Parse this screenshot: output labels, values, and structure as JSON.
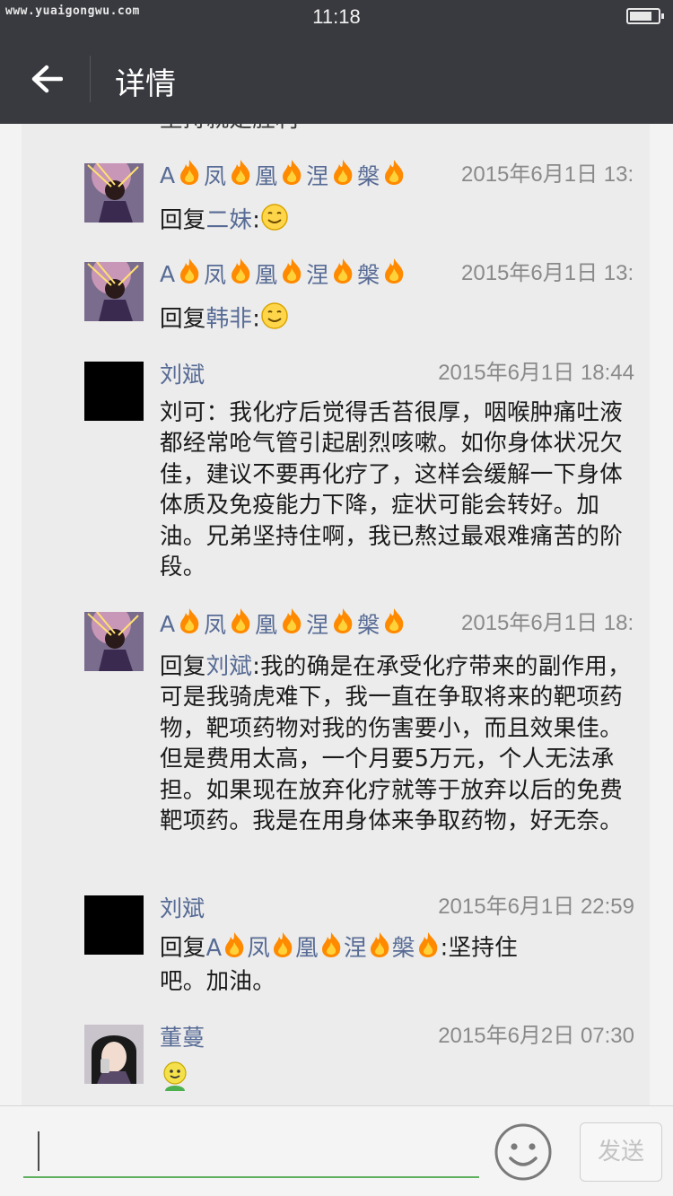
{
  "status_bar": {
    "watermark": "www.yuaigongwu.com",
    "time": "11:18"
  },
  "header": {
    "title": "详情"
  },
  "partial_message": "坚持就是胜利",
  "comments": [
    {
      "name_parts": [
        "A",
        "凤",
        "凰",
        "涅",
        "槃"
      ],
      "time": "2015年6月1日 13:",
      "reply_prefix": "回复",
      "reply_to": "二妹",
      "text": ":"
    },
    {
      "name_parts": [
        "A",
        "凤",
        "凰",
        "涅",
        "槃"
      ],
      "time": "2015年6月1日 13:",
      "reply_prefix": "回复",
      "reply_to": "韩非",
      "text": ":"
    },
    {
      "name": "刘斌",
      "time": "2015年6月1日 18:44",
      "text": "刘可：我化疗后觉得舌苔很厚，咽喉肿痛吐液都经常呛气管引起剧烈咳嗽。如你身体状况欠佳，建议不要再化疗了，这样会缓解一下身体体质及免疫能力下降，症状可能会转好。加油。兄弟坚持住啊，我已熬过最艰难痛苦的阶段。"
    },
    {
      "name_parts": [
        "A",
        "凤",
        "凰",
        "涅",
        "槃"
      ],
      "time": "2015年6月1日 18:",
      "reply_prefix": "回复",
      "reply_to": "刘斌",
      "text": ":我的确是在承受化疗带来的副作用，可是我骑虎难下，我一直在争取将来的靶项药物，靶项药物对我的伤害要小，而且效果佳。但是费用太高，一个月要5万元，个人无法承担。如果现在放弃化疗就等于放弃以后的免费靶项药。我是在用身体来争取药物，好无奈。"
    },
    {
      "name": "刘斌",
      "time": "2015年6月1日 22:59",
      "reply_prefix": "回复",
      "reply_to_parts": [
        "A",
        "凤",
        "凰",
        "涅",
        "槃"
      ],
      "text_line1": ":坚持住",
      "text_line2": "吧。加油。"
    },
    {
      "name": "董蔓",
      "time": "2015年6月2日 07:30"
    }
  ],
  "input_bar": {
    "send_label": "发送"
  },
  "icons": {
    "back": "arrow-left-icon",
    "emoji": "smiley-face-icon",
    "flame": "fire-emoji-icon",
    "smile": "smile-emoji-icon"
  },
  "colors": {
    "bar": "#393a3f",
    "link": "#576b95",
    "input_underline": "#5fb15f"
  }
}
